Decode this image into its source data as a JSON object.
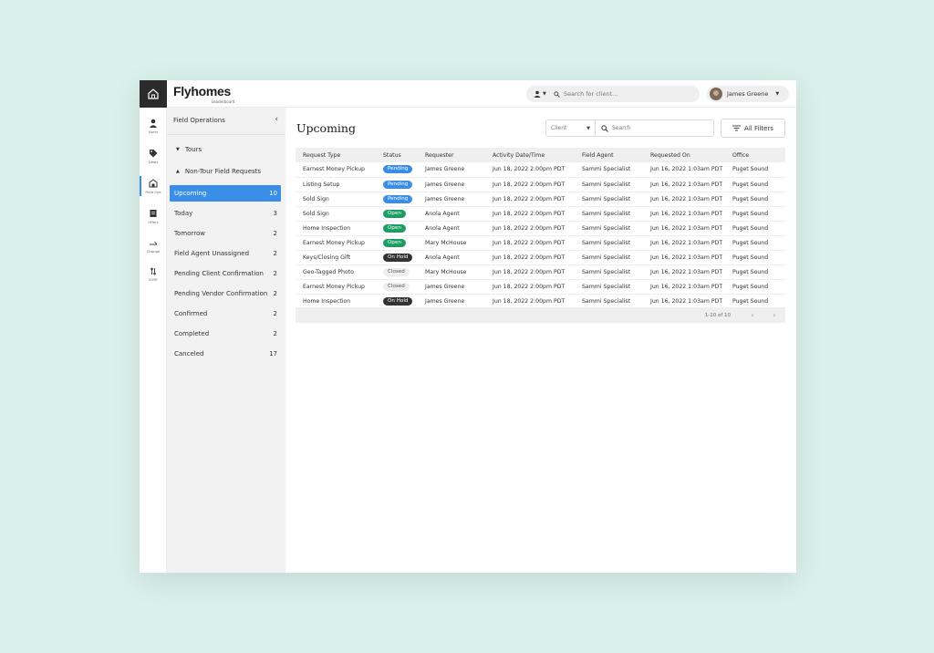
{
  "brand": {
    "name": "Flyhomes",
    "sub": "Leaderboard"
  },
  "topbar": {
    "search_placeholder": "Search for client...",
    "user_name": "James Greene"
  },
  "rail": [
    {
      "id": "users",
      "label": "Users"
    },
    {
      "id": "deals",
      "label": "Deals"
    },
    {
      "id": "field-ops",
      "label": "Field Ops"
    },
    {
      "id": "offers",
      "label": "Offers"
    },
    {
      "id": "change",
      "label": "Change"
    },
    {
      "id": "sort",
      "label": "SORT"
    }
  ],
  "sidebar": {
    "title": "Field Operations",
    "groups": [
      {
        "label": "Tours"
      },
      {
        "label": "Non-Tour Field Requests"
      }
    ],
    "items": [
      {
        "label": "Upcoming",
        "count": "10"
      },
      {
        "label": "Today",
        "count": "3"
      },
      {
        "label": "Tomorrow",
        "count": "2"
      },
      {
        "label": "Field Agent Unassigned",
        "count": "2"
      },
      {
        "label": "Pending Client Confirmation",
        "count": "2"
      },
      {
        "label": "Pending Vendor Confirmation",
        "count": "2"
      },
      {
        "label": "Confirmed",
        "count": "2"
      },
      {
        "label": "Completed",
        "count": "2"
      },
      {
        "label": "Canceled",
        "count": "17"
      }
    ]
  },
  "main": {
    "title": "Upcoming",
    "client_select": "Client",
    "search_placeholder": "Search",
    "filters_label": "All Filters",
    "columns": [
      "Request Type",
      "Status",
      "Requester",
      "Activity Date/Time",
      "Field Agent",
      "Requested On",
      "Office"
    ],
    "rows": [
      {
        "type": "Earnest Money Pickup",
        "status": "Pending",
        "status_kind": "pending",
        "requester": "James Greene",
        "date": "Jun 18, 2022 2:00pm PDT",
        "agent": "Sammi Specialist",
        "requested": "Jun 16, 2022 1:03am PDT",
        "office": "Puget Sound"
      },
      {
        "type": "Listing Setup",
        "status": "Pending",
        "status_kind": "pending",
        "requester": "James Greene",
        "date": "Jun 18, 2022 2:00pm PDT",
        "agent": "Sammi Specialist",
        "requested": "Jun 16, 2022 1:03am PDT",
        "office": "Puget Sound"
      },
      {
        "type": "Sold Sign",
        "status": "Pending",
        "status_kind": "pending",
        "requester": "James Greene",
        "date": "Jun 18, 2022 2:00pm PDT",
        "agent": "Sammi Specialist",
        "requested": "Jun 16, 2022 1:03am PDT",
        "office": "Puget Sound"
      },
      {
        "type": "Sold Sign",
        "status": "Open",
        "status_kind": "open",
        "requester": "Anola Agent",
        "date": "Jun 18, 2022 2:00pm PDT",
        "agent": "Sammi Specialist",
        "requested": "Jun 16, 2022 1:03am PDT",
        "office": "Puget Sound"
      },
      {
        "type": "Home Inspection",
        "status": "Open",
        "status_kind": "open",
        "requester": "Anola Agent",
        "date": "Jun 18, 2022 2:00pm PDT",
        "agent": "Sammi Specialist",
        "requested": "Jun 16, 2022 1:03am PDT",
        "office": "Puget Sound"
      },
      {
        "type": "Earnest Money Pickup",
        "status": "Open",
        "status_kind": "open",
        "requester": "Mary McHouse",
        "date": "Jun 18, 2022 2:00pm PDT",
        "agent": "Sammi Specialist",
        "requested": "Jun 16, 2022 1:03am PDT",
        "office": "Puget Sound"
      },
      {
        "type": "Keys/Closing Gift",
        "status": "On Hold",
        "status_kind": "onhold",
        "requester": "Anola Agent",
        "date": "Jun 18, 2022 2:00pm PDT",
        "agent": "Sammi Specialist",
        "requested": "Jun 16, 2022 1:03am PDT",
        "office": "Puget Sound"
      },
      {
        "type": "Geo-Tagged Photo",
        "status": "Closed",
        "status_kind": "closed",
        "requester": "Mary McHouse",
        "date": "Jun 18, 2022 2:00pm PDT",
        "agent": "Sammi Specialist",
        "requested": "Jun 16, 2022 1:03am PDT",
        "office": "Puget Sound"
      },
      {
        "type": "Earnest Money Pickup",
        "status": "Closed",
        "status_kind": "closed",
        "requester": "James Greene",
        "date": "Jun 18, 2022 2:00pm PDT",
        "agent": "Sammi Specialist",
        "requested": "Jun 16, 2022 1:03am PDT",
        "office": "Puget Sound"
      },
      {
        "type": "Home Inspection",
        "status": "On Hold",
        "status_kind": "onhold",
        "requester": "James Greene",
        "date": "Jun 18, 2022 2:00pm PDT",
        "agent": "Sammi Specialist",
        "requested": "Jun 16, 2022 1:03am PDT",
        "office": "Puget Sound"
      }
    ],
    "pager_range": "1-10 of 10"
  },
  "colors": {
    "accent": "#3b8ee8",
    "open": "#1f9d63",
    "onhold": "#333333",
    "background": "#daf0eb"
  }
}
